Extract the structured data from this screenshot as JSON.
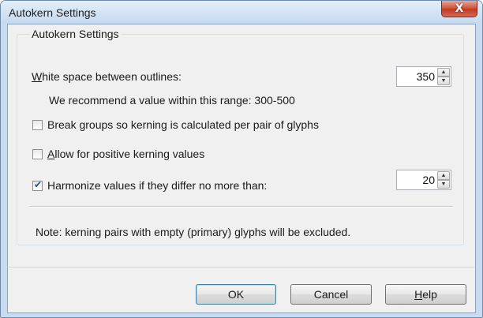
{
  "window": {
    "title": "Autokern Settings",
    "close_label": "X"
  },
  "group": {
    "legend": "Autokern Settings"
  },
  "whitespace": {
    "label_accel": "W",
    "label_rest": "hite space between outlines:",
    "value": "350",
    "recommendation": "We recommend a value within this range: 300-500"
  },
  "options": {
    "break_groups": {
      "label": "Break groups so kerning is calculated per pair of glyphs",
      "checked": false
    },
    "allow_positive": {
      "label_accel": "A",
      "label_rest": "llow for positive kerning values",
      "checked": false
    },
    "harmonize": {
      "label": "Harmonize values if they differ no more than:",
      "checked": true,
      "value": "20"
    }
  },
  "note": "Note: kerning pairs with empty (primary) glyphs will be excluded.",
  "buttons": {
    "ok": "OK",
    "cancel": "Cancel",
    "help_accel": "H",
    "help_rest": "elp"
  },
  "glyphs": {
    "checkmark": "✔",
    "spin_up": "▲",
    "spin_down": "▼"
  }
}
